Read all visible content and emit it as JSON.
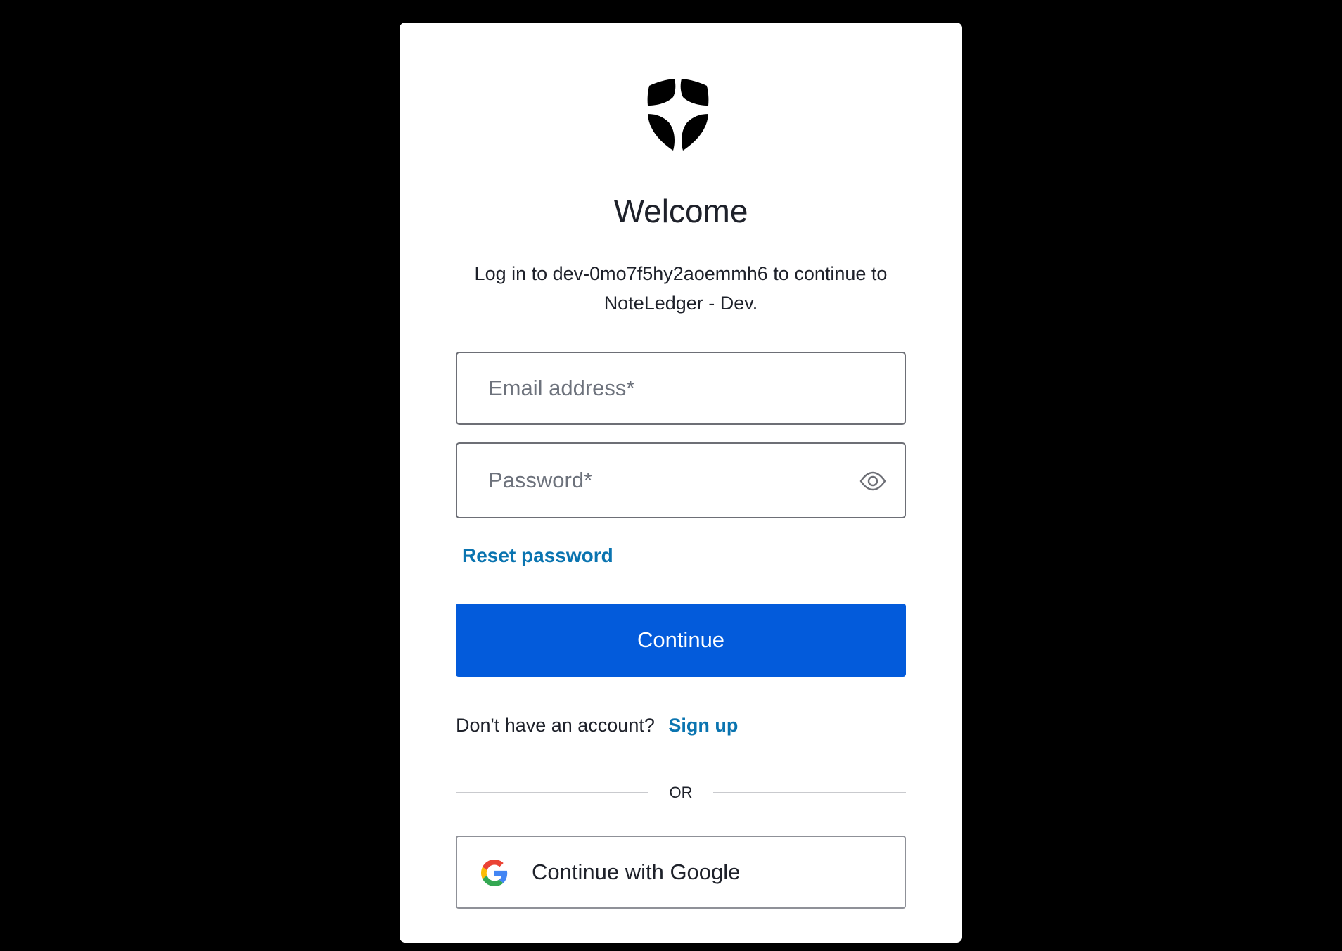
{
  "login": {
    "logo_icon": "shield-star-logo",
    "title": "Welcome",
    "subtitle": "Log in to dev-0mo7f5hy2aoemmh6 to continue to NoteLedger - Dev.",
    "email": {
      "value": "",
      "placeholder": "Email address*"
    },
    "password": {
      "value": "",
      "placeholder": "Password*",
      "toggle_icon": "eye-icon"
    },
    "reset_password_label": "Reset password",
    "continue_label": "Continue",
    "signup_prompt": "Don't have an account?",
    "signup_link": "Sign up",
    "divider_label": "OR",
    "google": {
      "icon": "google-g-icon",
      "label": "Continue with Google"
    }
  },
  "colors": {
    "background": "#000000",
    "card": "#ffffff",
    "primary_button": "#035bdb",
    "link": "#0a74b0",
    "text": "#1e212a",
    "placeholder": "#6d727c"
  }
}
